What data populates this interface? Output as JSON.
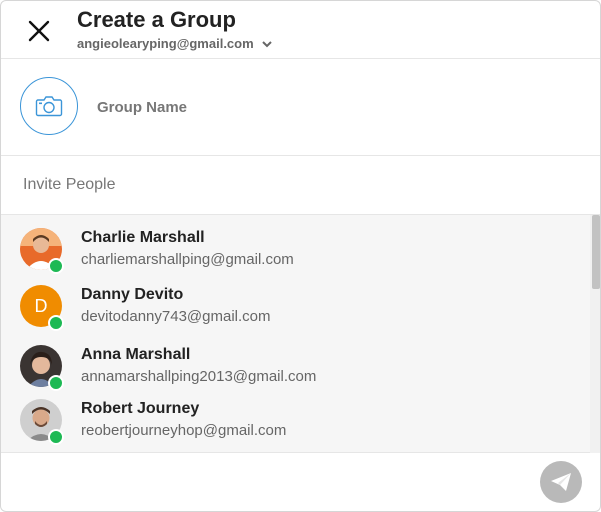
{
  "header": {
    "title": "Create a Group",
    "account_email": "angieolearyping@gmail.com",
    "close_icon": "close-icon",
    "dropdown_icon": "chevron-down-icon"
  },
  "group": {
    "name_placeholder": "Group Name",
    "photo_icon": "camera-icon"
  },
  "invite": {
    "placeholder": "Invite People"
  },
  "contacts": [
    {
      "name": "Charlie Marshall",
      "email": "charliemarshallping@gmail.com",
      "avatar": "photo",
      "online": true
    },
    {
      "name": "Danny Devito",
      "email": "devitodanny743@gmail.com",
      "avatar": "D",
      "online": true
    },
    {
      "name": "Anna Marshall",
      "email": "annamarshallping2013@gmail.com",
      "avatar": "photo",
      "online": true
    },
    {
      "name": "Robert Journey",
      "email": "reobertjourneyhop@gmail.com",
      "avatar": "photo",
      "online": true
    }
  ],
  "footer": {
    "send_icon": "paper-plane-icon"
  },
  "colors": {
    "accent": "#3b95d8",
    "online": "#1db954",
    "letter_avatar": "#f08c00",
    "send_disabled": "#b9b9b9"
  }
}
